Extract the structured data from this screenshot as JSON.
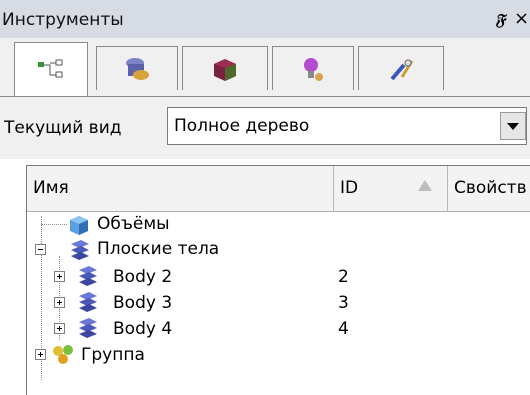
{
  "window": {
    "title": "Инструменты",
    "pin_glyph": "🗗",
    "close_glyph": "×"
  },
  "tabs": [
    {
      "icon": "tree-node-icon",
      "active": true
    },
    {
      "icon": "bodies-icon",
      "active": false
    },
    {
      "icon": "material-cube-icon",
      "active": false
    },
    {
      "icon": "light-bulb-icon",
      "active": false
    },
    {
      "icon": "tools-icon",
      "active": false
    }
  ],
  "view": {
    "label": "Текущий вид",
    "selected": "Полное дерево"
  },
  "columns": {
    "name": "Имя",
    "id": "ID",
    "props": "Свойств"
  },
  "rows": [
    {
      "label": "Объёмы",
      "id": "",
      "icon": "volume-icon"
    },
    {
      "label": "Плоские тела",
      "id": "",
      "icon": "flat-bodies-icon"
    },
    {
      "label": "Body 2",
      "id": "2",
      "icon": "body-icon"
    },
    {
      "label": "Body 3",
      "id": "3",
      "icon": "body-icon"
    },
    {
      "label": "Body 4",
      "id": "4",
      "icon": "body-icon"
    },
    {
      "label": "Группа",
      "id": "",
      "icon": "group-icon"
    }
  ]
}
